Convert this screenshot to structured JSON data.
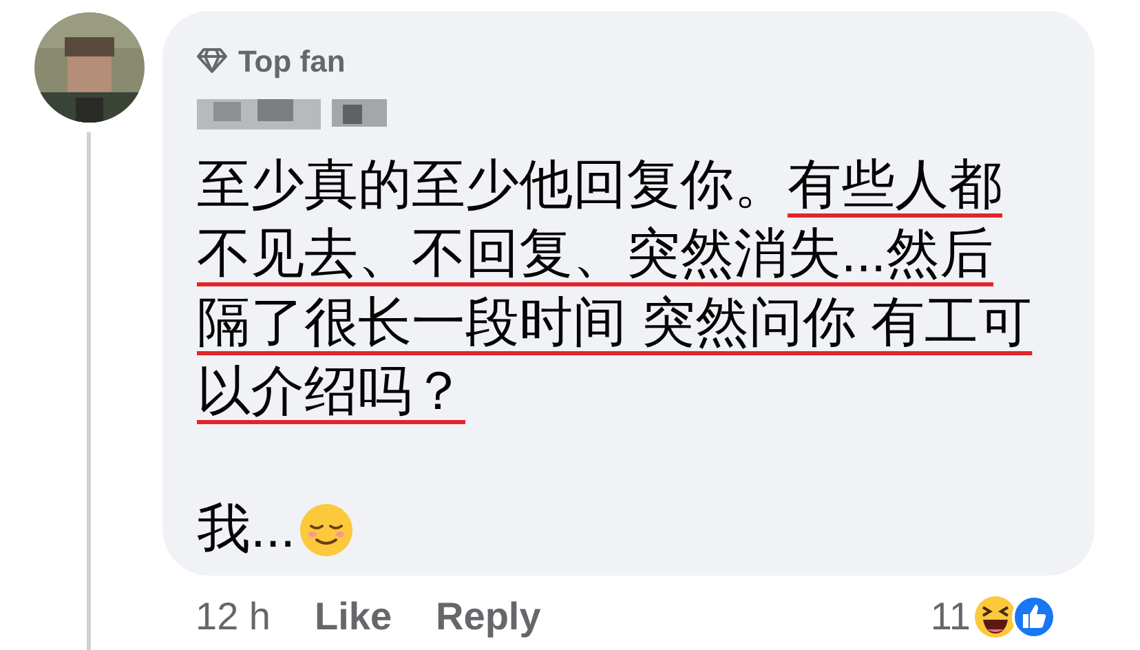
{
  "comment": {
    "badge": "Top fan",
    "lines": [
      [
        {
          "text": "至少真的至少他回复你。",
          "underlined": false
        },
        {
          "text": "有些人都",
          "underlined": true
        }
      ],
      [
        {
          "text": "不见去、不回复、突然消失...然后",
          "underlined": true
        }
      ],
      [
        {
          "text": "隔了很长一段时间 突然问你 有工可",
          "underlined": true
        }
      ],
      [
        {
          "text": "以介绍吗？",
          "underlined": true
        }
      ]
    ],
    "last_line": "我...",
    "time": "12 h",
    "actions": [
      "Like",
      "Reply"
    ],
    "reaction_count": "11"
  }
}
